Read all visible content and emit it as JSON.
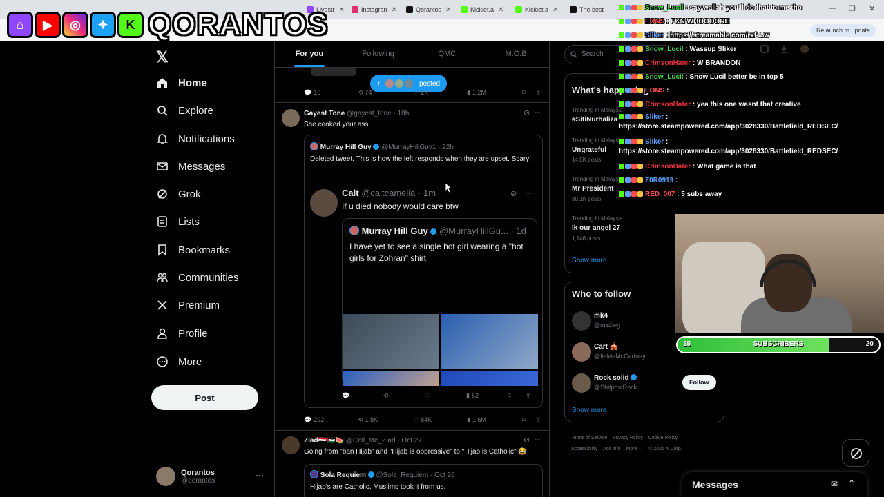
{
  "browser": {
    "tabs": [
      {
        "title": "Livestr",
        "color": "#9147ff"
      },
      {
        "title": "Instagran",
        "color": "#e1306c"
      },
      {
        "title": "Qorantos",
        "color": "#111111"
      },
      {
        "title": "Kicklet.a",
        "color": "#53fc18"
      },
      {
        "title": "Kicklet.a",
        "color": "#53fc18"
      },
      {
        "title": "The best",
        "color": "#111111"
      }
    ],
    "relaunch_label": "Relaunch to update"
  },
  "overlay": {
    "channel_name": "QORANTOS",
    "brand_icons": [
      "twitch-icon",
      "youtube-icon",
      "instagram-icon",
      "twitter-icon",
      "kick-icon"
    ]
  },
  "nav": {
    "items": [
      {
        "label": "Home",
        "icon": "home-icon"
      },
      {
        "label": "Explore",
        "icon": "search-icon"
      },
      {
        "label": "Notifications",
        "icon": "bell-icon"
      },
      {
        "label": "Messages",
        "icon": "envelope-icon"
      },
      {
        "label": "Grok",
        "icon": "grok-icon"
      },
      {
        "label": "Lists",
        "icon": "list-icon"
      },
      {
        "label": "Bookmarks",
        "icon": "bookmark-icon"
      },
      {
        "label": "Communities",
        "icon": "people-icon"
      },
      {
        "label": "Premium",
        "icon": "x-icon"
      },
      {
        "label": "Profile",
        "icon": "person-icon"
      },
      {
        "label": "More",
        "icon": "more-circle-icon"
      }
    ],
    "post_label": "Post",
    "account": {
      "name": "Qorantos",
      "handle": "@qorantos"
    }
  },
  "timeline": {
    "tabs": [
      "For you",
      "Following",
      "QMC",
      "M.O.B"
    ],
    "posted_label": "posted",
    "top_actions": {
      "replies": "16",
      "reposts": "74",
      "likes": "2K",
      "views": "1.2M"
    },
    "tweet1": {
      "name": "Gayest Tone",
      "handle": "@gayest_tone · 18h",
      "text": "She cooked your ass",
      "quote": {
        "name": "Murray Hill Guy",
        "handle": "@MurrayHillGuy1 · 22h",
        "text": "Deleted tweet. This is how the left responds when they are upset. Scary!",
        "inner": {
          "name": "Cait",
          "handle": "@caitcamelia · 1m",
          "text": "If u died nobody would care btw",
          "quote": {
            "name": "Murray Hill Guy",
            "handle": "@MurrayHillGu... · 1d",
            "text": "I have yet to see a single hot girl wearing a \"hot girls for Zohran\" shirt"
          },
          "views": "62"
        }
      },
      "actions": {
        "replies": "292",
        "reposts": "1.8K",
        "likes": "84K",
        "views": "1.6M"
      }
    },
    "tweet2": {
      "name": "Ziad🇪🇬🇵🇸🍉",
      "handle": "@Call_Me_Ziad · Oct 27",
      "text": "Going from \"ban Hijab\" and \"Hijab is oppressive\" to \"Hijab is Catholic\" 😂",
      "quote": {
        "name": "Sola Requiem",
        "handle": "@Sola_Requiem · Oct 26",
        "text": "Hijab's are Catholic, Muslims took it from us."
      }
    }
  },
  "sidebar": {
    "search_placeholder": "Search",
    "trends_title": "What's happening",
    "trends": [
      {
        "context": "Trending in Malaysia",
        "name": "#SitiNurhaliza",
        "count": ""
      },
      {
        "context": "Trending in Malaysia",
        "name": "Ungrateful",
        "count": "14.8K posts"
      },
      {
        "context": "Trending in Malaysia",
        "name": "Mr President",
        "count": "30.1K posts"
      },
      {
        "context": "Trending in Malaysia",
        "name": "Ik our angel 27",
        "count": "1,146 posts"
      }
    ],
    "show_more": "Show more",
    "who_to_follow_title": "Who to follow",
    "follow_suggestions": [
      {
        "name": "mk4",
        "handle": "@mk4leg"
      },
      {
        "name": "Cart 🎪",
        "handle": "@ItsMeMcCartney"
      },
      {
        "name": "Rock solid",
        "handle": "@ShitpostRock"
      }
    ],
    "follow_label": "Follow",
    "footer": [
      "Terms of Service",
      "Privacy Policy",
      "Cookie Policy",
      "Accessibility",
      "Ads info",
      "More ···",
      "© 2025 X Corp."
    ]
  },
  "chat": [
    {
      "user": "Snow_Lucil",
      "color": "#3cd94a",
      "msg": "say wallah you'll do that to me tho"
    },
    {
      "user": "EONS",
      "color": "#ff4d4d",
      "msg": "FKN WHOOOORE"
    },
    {
      "user": "Sliker",
      "color": "#5aa0ff",
      "msg": "https://streamable.com/rxf48w"
    },
    {
      "user": "Snow_Lucil",
      "color": "#3cd94a",
      "msg": "Wassup Sliker"
    },
    {
      "user": "CrimsonHater",
      "color": "#e0303a",
      "msg": "W BRANDON"
    },
    {
      "user": "Snow_Lucil",
      "color": "#3cd94a",
      "msg": "Snow Lucil better be in top 5"
    },
    {
      "user": "EONS",
      "color": "#ff4d4d",
      "msg": ""
    },
    {
      "user": "CrimsonHater",
      "color": "#e0303a",
      "msg": "yea this one wasnt that creative"
    },
    {
      "user": "Sliker",
      "color": "#5aa0ff",
      "msg": ""
    },
    {
      "user": "Sliker",
      "color": "#5aa0ff",
      "msg": ""
    },
    {
      "user": "CrimsonHater",
      "color": "#e0303a",
      "msg": "What game is that"
    },
    {
      "user": "Z0R0919",
      "color": "#5aa0ff",
      "msg": ""
    },
    {
      "user": "RED_007",
      "color": "#ff4d4d",
      "msg": "5 subs away"
    }
  ],
  "chat_links": [
    "https://store.steampowered.com/app/3028330/Battlefield_REDSEC/",
    "https://store.steampowered.com/app/3028330/Battlefield_REDSEC/"
  ],
  "sub_goal": {
    "label": "SUBSCRIBERS",
    "current": "15",
    "target": "20",
    "progress": 0.75
  },
  "messages_drawer": {
    "title": "Messages"
  }
}
